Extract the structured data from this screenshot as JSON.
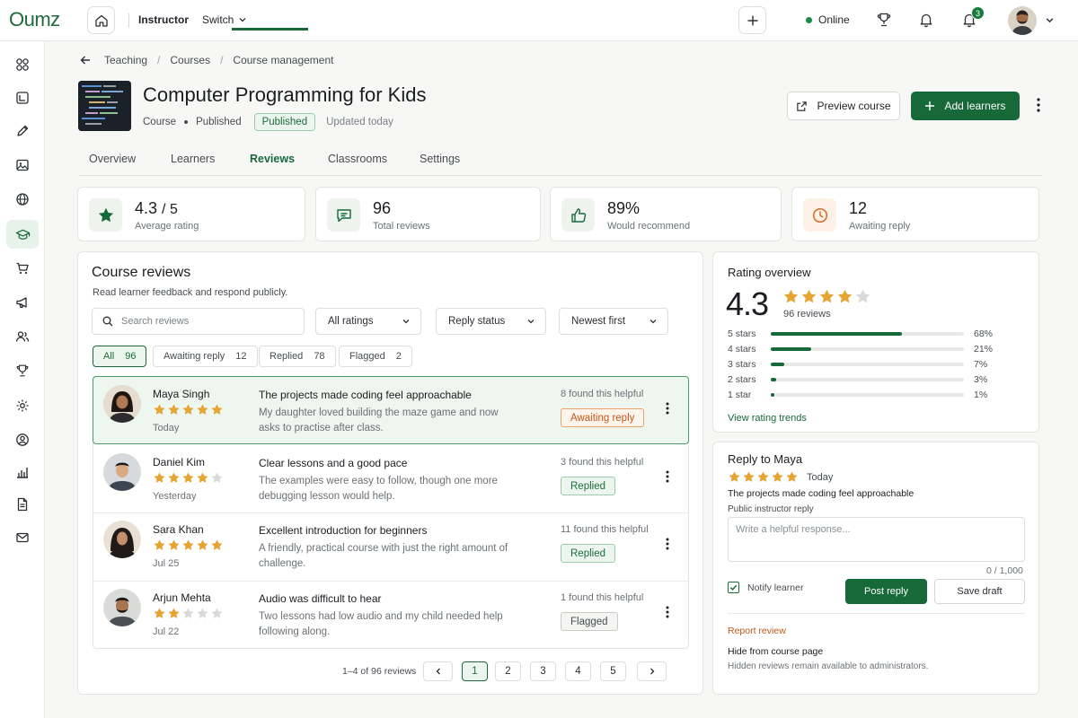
{
  "brand": {
    "logo": "Oumz",
    "accent": "#17693a"
  },
  "topbar": {
    "role": "Instructor",
    "switch_label": "Switch",
    "status": "Online",
    "notification_count": "3",
    "icons": [
      "home-icon",
      "plus-icon",
      "trophy-icon",
      "bell-icon",
      "notification-bell-icon",
      "avatar",
      "chevron-down-icon"
    ]
  },
  "sidebar": {
    "active_index": 5,
    "icons": [
      "apps-icon",
      "reports-icon",
      "pencil-icon",
      "image-icon",
      "globe-icon",
      "graduation-cap-icon",
      "cart-icon",
      "megaphone-icon",
      "users-icon",
      "trophy-icon",
      "gear-icon",
      "user-circle-icon",
      "bar-chart-icon",
      "document-icon",
      "mail-icon"
    ]
  },
  "breadcrumb": {
    "items": [
      "Teaching",
      "Courses",
      "Course management"
    ]
  },
  "course": {
    "title": "Computer Programming for Kids",
    "type": "Course",
    "state": "Published",
    "badge": "Published",
    "updated": "Updated today"
  },
  "actions": {
    "preview": "Preview course",
    "add": "Add learners"
  },
  "tabs": [
    {
      "label": "Overview",
      "active": false
    },
    {
      "label": "Learners",
      "active": false
    },
    {
      "label": "Reviews",
      "active": true
    },
    {
      "label": "Classrooms",
      "active": false
    },
    {
      "label": "Settings",
      "active": false
    }
  ],
  "stats": [
    {
      "value": "4.3",
      "suffix": "/ 5",
      "label": "Average rating",
      "icon": "star-icon"
    },
    {
      "value": "96",
      "suffix": "",
      "label": "Total reviews",
      "icon": "chat-icon"
    },
    {
      "value": "89%",
      "suffix": "",
      "label": "Would recommend",
      "icon": "thumbs-up-icon"
    },
    {
      "value": "12",
      "suffix": "",
      "label": "Awaiting reply",
      "icon": "clock-icon"
    }
  ],
  "reviews_panel": {
    "title": "Course reviews",
    "subtitle": "Read learner feedback and respond publicly.",
    "search_placeholder": "Search reviews",
    "filters": [
      "All ratings",
      "Reply status",
      "Newest first"
    ],
    "chips": [
      {
        "label": "All",
        "count": "96",
        "active": true
      },
      {
        "label": "Awaiting reply",
        "count": "12",
        "active": false
      },
      {
        "label": "Replied",
        "count": "78",
        "active": false
      },
      {
        "label": "Flagged",
        "count": "2",
        "active": false
      }
    ],
    "reviews": [
      {
        "name": "Maya Singh",
        "rating": 5,
        "date": "Today",
        "title": "The projects made coding feel approachable",
        "body": "My daughter loved building the maze game and now asks to practise after class.",
        "helpful": "8 found this helpful",
        "status": "Awaiting reply",
        "status_kind": "await",
        "selected": true
      },
      {
        "name": "Daniel Kim",
        "rating": 4,
        "date": "Yesterday",
        "title": "Clear lessons and a good pace",
        "body": "The examples were easy to follow, though one more debugging lesson would help.",
        "helpful": "3 found this helpful",
        "status": "Replied",
        "status_kind": "replied",
        "selected": false
      },
      {
        "name": "Sara Khan",
        "rating": 5,
        "date": "Jul 25",
        "title": "Excellent introduction for beginners",
        "body": "A friendly, practical course with just the right amount of challenge.",
        "helpful": "11 found this helpful",
        "status": "Replied",
        "status_kind": "replied",
        "selected": false
      },
      {
        "name": "Arjun Mehta",
        "rating": 2,
        "date": "Jul 22",
        "title": "Audio was difficult to hear",
        "body": "Two lessons had low audio and my child needed help following along.",
        "helpful": "1 found this helpful",
        "status": "Flagged",
        "status_kind": "flag",
        "selected": false
      }
    ],
    "pagination": {
      "info": "1–4 of 96 reviews",
      "pages": [
        "1",
        "2",
        "3",
        "4",
        "5"
      ],
      "current": "1"
    }
  },
  "rating_overview": {
    "title": "Rating overview",
    "average": "4.3",
    "average_stars": 4,
    "count": "96 reviews",
    "breakdown": [
      {
        "label": "5 stars",
        "pct": "68%",
        "value": 68
      },
      {
        "label": "4 stars",
        "pct": "21%",
        "value": 21
      },
      {
        "label": "3 stars",
        "pct": "7%",
        "value": 7
      },
      {
        "label": "2 stars",
        "pct": "3%",
        "value": 3
      },
      {
        "label": "1 star",
        "pct": "1%",
        "value": 1
      }
    ],
    "trend_link": "View rating trends"
  },
  "reply": {
    "title": "Reply to Maya",
    "rating": 5,
    "date": "Today",
    "review_title": "The projects made coding feel approachable",
    "label": "Public instructor reply",
    "placeholder": "Write a helpful response...",
    "counter": "0 / 1,000",
    "notify_label": "Notify learner",
    "notify_checked": true,
    "post": "Post reply",
    "draft": "Save draft",
    "report": "Report review",
    "hide_label": "Hide from course page",
    "hide_sub": "Hidden reviews remain available to administrators."
  }
}
